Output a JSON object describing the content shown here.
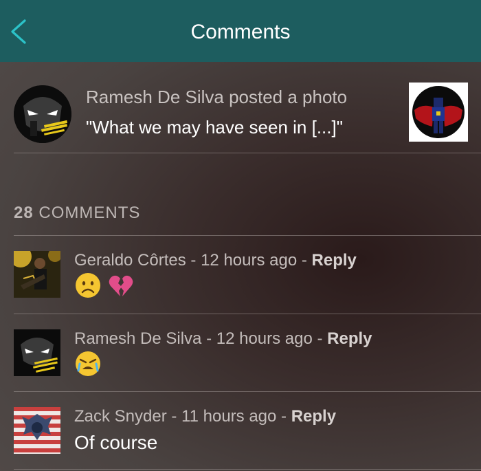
{
  "header": {
    "title": "Comments",
    "back_icon": "chevron-left-icon",
    "color": "#1d5d5f"
  },
  "post": {
    "line1": "Ramesh De Silva posted a photo",
    "caption": "\"What we may have seen in [...]\""
  },
  "comments_header": {
    "count": "28",
    "label": "COMMENTS"
  },
  "comments": [
    {
      "author": "Geraldo Côrtes",
      "time": "12 hours ago",
      "reply_label": "Reply",
      "body_icons": [
        "frowning-face-emoji",
        "broken-heart-emoji"
      ]
    },
    {
      "author": "Ramesh De Silva",
      "time": "12 hours ago",
      "reply_label": "Reply",
      "body_icons": [
        "crying-face-emoji"
      ]
    },
    {
      "author": "Zack Snyder",
      "time": "11 hours ago",
      "reply_label": "Reply",
      "body": "Of course"
    }
  ],
  "separator": " - "
}
